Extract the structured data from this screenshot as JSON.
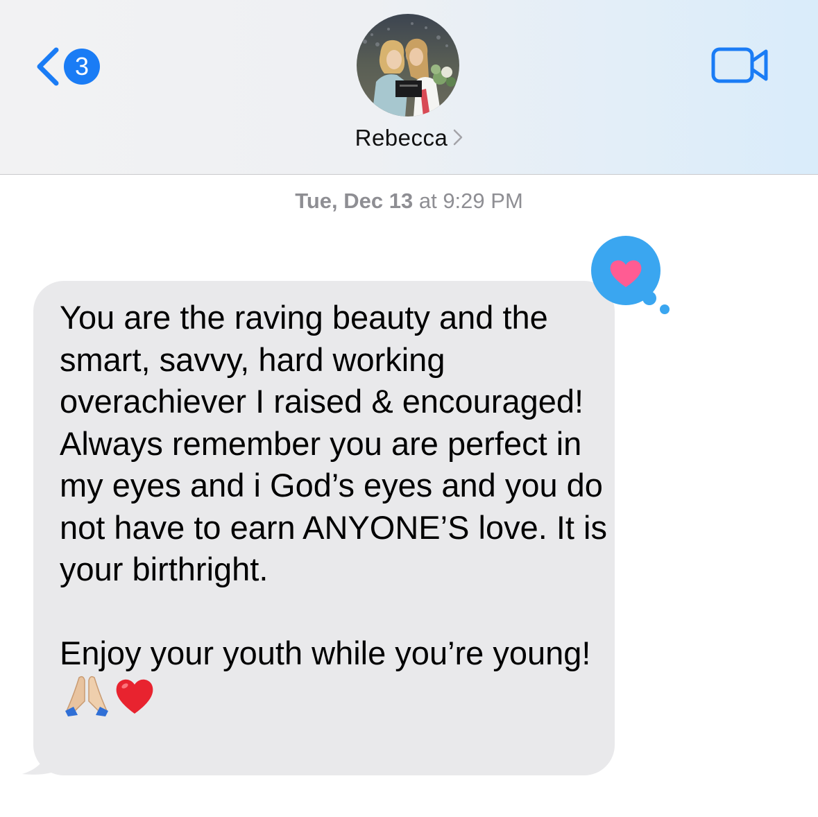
{
  "header": {
    "back_badge_count": "3",
    "contact_name": "Rebecca",
    "icons": {
      "back": "chevron-left-icon",
      "details": "chevron-right-icon",
      "video": "video-camera-icon"
    }
  },
  "conversation": {
    "timestamp_day": "Tue, Dec 13",
    "timestamp_time": " at 9:29 PM",
    "messages": [
      {
        "direction": "incoming",
        "text": "You are the raving beauty and the smart, savvy, hard working overachiever I raised & encouraged!  Always remember you are perfect in my eyes and i God’s eyes and you do not have to earn ANYONE’S love. It is your birthright.\n\nEnjoy your youth while you’re young!",
        "emojis": [
          "folded-hands-emoji",
          "red-heart-emoji"
        ],
        "tapback": "heart"
      }
    ]
  },
  "colors": {
    "accent": "#1a7cf5",
    "bubble_incoming": "#e9e9eb",
    "tapback_bubble": "#3aa6f0",
    "tapback_heart": "#ff5c93",
    "timestamp": "#8e8e93"
  }
}
